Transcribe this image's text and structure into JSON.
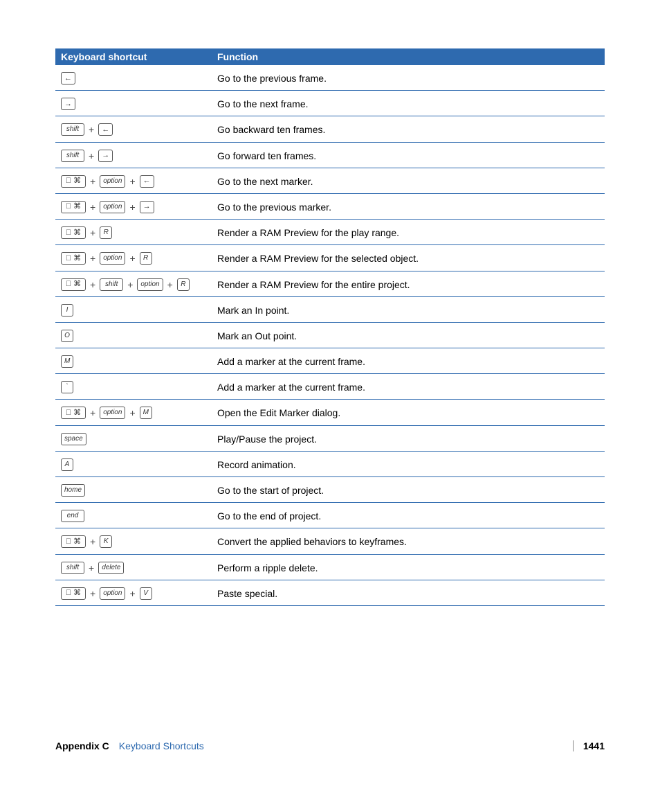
{
  "header": {
    "shortcut": "Keyboard shortcut",
    "function": "Function"
  },
  "footer": {
    "appendix": "Appendix C",
    "title": "Keyboard Shortcuts",
    "page": "1441"
  },
  "rows": [
    {
      "keys": [
        {
          "t": "arrow",
          "v": "←"
        }
      ],
      "fn": "Go to the previous frame."
    },
    {
      "keys": [
        {
          "t": "arrow",
          "v": "→"
        }
      ],
      "fn": "Go to the next frame."
    },
    {
      "keys": [
        {
          "t": "txt",
          "v": "shift",
          "w": true
        },
        {
          "t": "plus"
        },
        {
          "t": "arrow",
          "v": "←"
        }
      ],
      "fn": "Go backward ten frames."
    },
    {
      "keys": [
        {
          "t": "txt",
          "v": "shift",
          "w": true
        },
        {
          "t": "plus"
        },
        {
          "t": "arrow",
          "v": "→"
        }
      ],
      "fn": "Go forward ten frames."
    },
    {
      "keys": [
        {
          "t": "cmd"
        },
        {
          "t": "plus"
        },
        {
          "t": "txt",
          "v": "option",
          "w": true
        },
        {
          "t": "plus"
        },
        {
          "t": "arrow",
          "v": "←"
        }
      ],
      "fn": "Go to the next marker."
    },
    {
      "keys": [
        {
          "t": "cmd"
        },
        {
          "t": "plus"
        },
        {
          "t": "txt",
          "v": "option",
          "w": true
        },
        {
          "t": "plus"
        },
        {
          "t": "arrow",
          "v": "→"
        }
      ],
      "fn": "Go to the previous marker."
    },
    {
      "keys": [
        {
          "t": "cmd"
        },
        {
          "t": "plus"
        },
        {
          "t": "txt",
          "v": "R"
        }
      ],
      "fn": "Render a RAM Preview for the play range."
    },
    {
      "keys": [
        {
          "t": "cmd"
        },
        {
          "t": "plus"
        },
        {
          "t": "txt",
          "v": "option",
          "w": true
        },
        {
          "t": "plus"
        },
        {
          "t": "txt",
          "v": "R"
        }
      ],
      "fn": "Render a RAM Preview for the selected object."
    },
    {
      "keys": [
        {
          "t": "cmd"
        },
        {
          "t": "plus"
        },
        {
          "t": "txt",
          "v": "shift",
          "w": true
        },
        {
          "t": "plus"
        },
        {
          "t": "txt",
          "v": "option",
          "w": true
        },
        {
          "t": "plus"
        },
        {
          "t": "txt",
          "v": "R"
        }
      ],
      "fn": "Render a RAM Preview for the entire project."
    },
    {
      "keys": [
        {
          "t": "txt",
          "v": "I"
        }
      ],
      "fn": "Mark an In point."
    },
    {
      "keys": [
        {
          "t": "txt",
          "v": "O"
        }
      ],
      "fn": "Mark an Out point."
    },
    {
      "keys": [
        {
          "t": "txt",
          "v": "M"
        }
      ],
      "fn": "Add a marker at the current frame."
    },
    {
      "keys": [
        {
          "t": "txt",
          "v": "`"
        }
      ],
      "fn": "Add a marker at the current frame."
    },
    {
      "keys": [
        {
          "t": "cmd"
        },
        {
          "t": "plus"
        },
        {
          "t": "txt",
          "v": "option",
          "w": true
        },
        {
          "t": "plus"
        },
        {
          "t": "txt",
          "v": "M"
        }
      ],
      "fn": "Open the Edit Marker dialog."
    },
    {
      "keys": [
        {
          "t": "txt",
          "v": "space",
          "w": true
        }
      ],
      "fn": "Play/Pause the project."
    },
    {
      "keys": [
        {
          "t": "txt",
          "v": "A"
        }
      ],
      "fn": "Record animation."
    },
    {
      "keys": [
        {
          "t": "txt",
          "v": "home",
          "w": true
        }
      ],
      "fn": "Go to the start of project."
    },
    {
      "keys": [
        {
          "t": "txt",
          "v": "end",
          "w": true
        }
      ],
      "fn": "Go to the end of project."
    },
    {
      "keys": [
        {
          "t": "cmd"
        },
        {
          "t": "plus"
        },
        {
          "t": "txt",
          "v": "K"
        }
      ],
      "fn": "Convert the applied behaviors to keyframes."
    },
    {
      "keys": [
        {
          "t": "txt",
          "v": "shift",
          "w": true
        },
        {
          "t": "plus"
        },
        {
          "t": "txt",
          "v": "delete",
          "w": true
        }
      ],
      "fn": "Perform a ripple delete."
    },
    {
      "keys": [
        {
          "t": "cmd"
        },
        {
          "t": "plus"
        },
        {
          "t": "txt",
          "v": "option",
          "w": true
        },
        {
          "t": "plus"
        },
        {
          "t": "txt",
          "v": "V"
        }
      ],
      "fn": "Paste special."
    }
  ]
}
